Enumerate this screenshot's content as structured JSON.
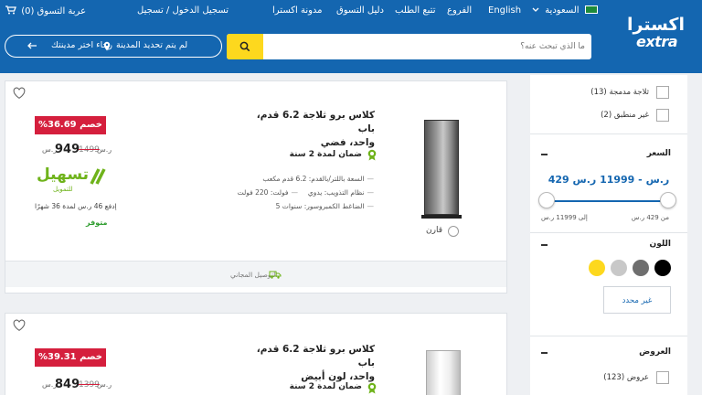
{
  "header": {
    "logo_ar": "اكسترا",
    "logo_en": "extra",
    "country": "السعودية",
    "language": "English",
    "branches": "الفروع",
    "track_order": "تتبع الطلب",
    "shopping_guide": "دليل التسوق",
    "blog": "مدونة اكسترا",
    "login": "تسجيل الدخول / تسجيل",
    "cart": "عربة التسوق (0)",
    "search_placeholder": "ما الذي تبحث عنه؟",
    "city_status": "لم يتم تحديد المدينة",
    "city_prompt": "رجاء اختر مدينتك"
  },
  "products": [
    {
      "title_line1": "كلاس برو ثلاجة 6.2 قدم، باب",
      "title_line2": "واحد، فضي",
      "discount": "%36.69 خصم",
      "old_price": "1499",
      "old_cur": "ر.س",
      "new_price": "949",
      "new_cur": "ر.س",
      "warranty": "ضمان لمدة 2 سنة",
      "specs": [
        "السعة باللتر/بالقدم: 6.2 قدم مكعب",
        "نظام التذويب: يدوي",
        "فولت: 220 فولت",
        "الضاغط الكمبروسور: سنوات 5"
      ],
      "tas_brand": "تسهيل",
      "tas_sub": "للتمويل",
      "installment": "إدفع 46 ر.س لمدة 36 شهرًا",
      "availability": "متوفر",
      "compare": "قارن",
      "delivery": "التوصيل المجاني"
    },
    {
      "title_line1": "كلاس برو ثلاجة 6.2 قدم، باب",
      "title_line2": "واحد، لون أبيض",
      "discount": "%39.31 خصم",
      "old_price": "1399",
      "old_cur": "ر.س",
      "new_price": "849",
      "new_cur": "ر.س",
      "warranty": "ضمان لمدة 2 سنة"
    }
  ],
  "sidebar": {
    "filters": [
      {
        "label": "ثلاجة مدمجة",
        "count": "(13)"
      },
      {
        "label": "غير منطبق",
        "count": "(2)"
      }
    ],
    "price": {
      "title": "السعر",
      "range": "429 ر.س - 11999 ر.س",
      "from": "من 429 ر.س",
      "to": "إلى 11999 ر.س"
    },
    "color": {
      "title": "اللون",
      "swatches": [
        "#000000",
        "#6e6e6e",
        "#c8c8c8",
        "#fdd81e"
      ],
      "unspecified": "غير محدد"
    },
    "offers": {
      "title": "العروض",
      "item_label": "عروض",
      "item_count": "(123)"
    }
  }
}
